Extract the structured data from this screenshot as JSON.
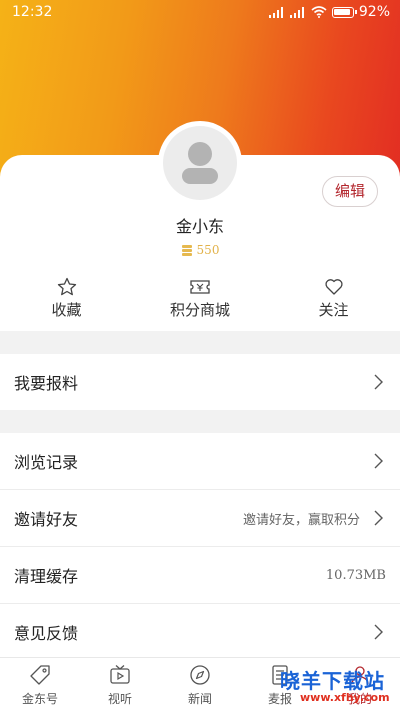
{
  "status_bar": {
    "time": "12:32",
    "battery": "92%"
  },
  "profile": {
    "name": "金小东",
    "points": "550",
    "edit_label": "编辑"
  },
  "quick_actions": [
    {
      "label": "收藏",
      "icon": "star-icon"
    },
    {
      "label": "积分商城",
      "icon": "ticket-icon"
    },
    {
      "label": "关注",
      "icon": "heart-icon"
    }
  ],
  "menu": {
    "report": {
      "label": "我要报料"
    },
    "history": {
      "label": "浏览记录"
    },
    "invite": {
      "label": "邀请好友",
      "value": "邀请好友，赢取积分"
    },
    "cache": {
      "label": "清理缓存",
      "value": "10.73MB"
    },
    "feedback": {
      "label": "意见反馈"
    }
  },
  "tabs": [
    {
      "label": "金东号",
      "icon": "tag-icon"
    },
    {
      "label": "视听",
      "icon": "tv-icon"
    },
    {
      "label": "新闻",
      "icon": "compass-icon"
    },
    {
      "label": "麦报",
      "icon": "document-icon"
    },
    {
      "label": "我的",
      "icon": "user-icon"
    }
  ],
  "watermark": {
    "main": "晓羊下载站",
    "sub": "www.xfhy.com"
  },
  "colors": {
    "accent": "#b3262d",
    "gradient_start": "#f5b217",
    "gradient_end": "#e22d23",
    "points": "#e2b24a"
  }
}
